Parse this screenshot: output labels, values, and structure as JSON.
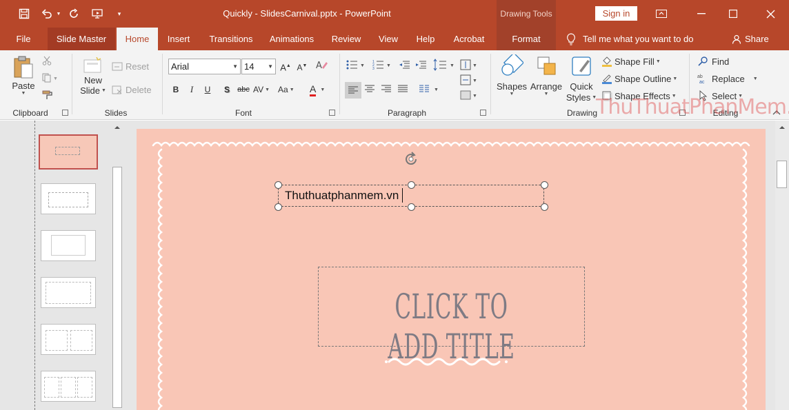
{
  "titlebar": {
    "title": "Quickly - SlidesCarnival.pptx  -  PowerPoint",
    "contextual_group": "Drawing Tools",
    "signin": "Sign in"
  },
  "tabs": [
    {
      "label": "File"
    },
    {
      "label": "Slide Master"
    },
    {
      "label": "Home"
    },
    {
      "label": "Insert"
    },
    {
      "label": "Transitions"
    },
    {
      "label": "Animations"
    },
    {
      "label": "Review"
    },
    {
      "label": "View"
    },
    {
      "label": "Help"
    },
    {
      "label": "Acrobat"
    },
    {
      "label": "Format"
    }
  ],
  "tell_me": "Tell me what you want to do",
  "share": "Share",
  "ribbon": {
    "clipboard": {
      "paste": "Paste",
      "label": "Clipboard"
    },
    "slides": {
      "new_slide_1": "New",
      "new_slide_2": "Slide",
      "reset": "Reset",
      "delete": "Delete",
      "label": "Slides"
    },
    "font": {
      "name": "Arial",
      "size": "14",
      "bold": "B",
      "italic": "I",
      "underline": "U",
      "shadow": "S",
      "strike": "abc",
      "spacing": "AV",
      "case": "Aa",
      "color": "A",
      "label": "Font"
    },
    "paragraph": {
      "label": "Paragraph"
    },
    "drawing": {
      "shapes": "Shapes",
      "arrange": "Arrange",
      "quick_1": "Quick",
      "quick_2": "Styles",
      "fill": "Shape Fill",
      "outline": "Shape Outline",
      "effects": "Shape Effects",
      "label": "Drawing"
    },
    "editing": {
      "find": "Find",
      "replace": "Replace",
      "select": "Select",
      "label": "Editing"
    }
  },
  "slide": {
    "textbox_text": "Thuthuatphanmem.vn",
    "title_placeholder": "Click to add title"
  },
  "watermark": "ThuThuatPhanMem.vn",
  "colors": {
    "accent": "#b7472a",
    "slide_bg": "#f9c6b6"
  }
}
